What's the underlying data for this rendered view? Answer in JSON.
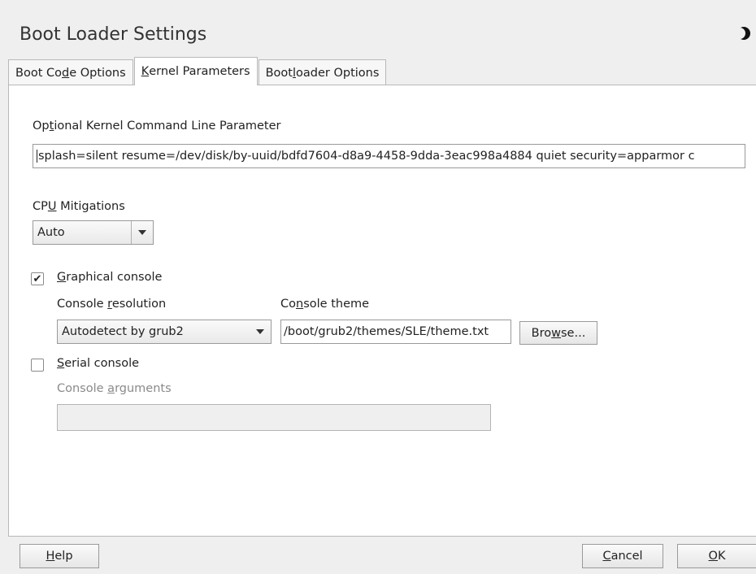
{
  "window": {
    "title": "Boot Loader Settings"
  },
  "tabs": [
    {
      "label_pre": "Boot Co",
      "label_u": "d",
      "label_post": "e Options"
    },
    {
      "label_pre": "",
      "label_u": "K",
      "label_post": "ernel Parameters"
    },
    {
      "label_pre": "Boot",
      "label_u": "l",
      "label_post": "oader Options"
    }
  ],
  "kernel": {
    "cmdline_label_pre": "Op",
    "cmdline_label_u": "t",
    "cmdline_label_post": "ional Kernel Command Line Parameter",
    "cmdline_value": "splash=silent resume=/dev/disk/by-uuid/bdfd7604-d8a9-4458-9dda-3eac998a4884  quiet security=apparmor c",
    "cpu_label_pre": "CP",
    "cpu_label_u": "U",
    "cpu_label_post": " Mitigations",
    "cpu_value": "Auto"
  },
  "graphical": {
    "checked": true,
    "label_u": "G",
    "label_post": "raphical console",
    "resolution_label_pre": "Console ",
    "resolution_label_u": "r",
    "resolution_label_post": "esolution",
    "resolution_value": "Autodetect by grub2",
    "theme_label_pre": "Co",
    "theme_label_u": "n",
    "theme_label_post": "sole theme",
    "theme_value": "/boot/grub2/themes/SLE/theme.txt",
    "browse_pre": "Bro",
    "browse_u": "w",
    "browse_post": "se..."
  },
  "serial": {
    "checked": false,
    "label_u": "S",
    "label_post": "erial console",
    "args_label_pre": "Console ",
    "args_label_u": "a",
    "args_label_post": "rguments",
    "args_value": ""
  },
  "footer": {
    "help_u": "H",
    "help_post": "elp",
    "cancel_u": "C",
    "cancel_post": "ancel",
    "ok_u": "O",
    "ok_post": "K"
  },
  "icons": {
    "status": "moon-icon",
    "check": "checkmark-icon",
    "dropdown": "chevron-down-icon"
  }
}
